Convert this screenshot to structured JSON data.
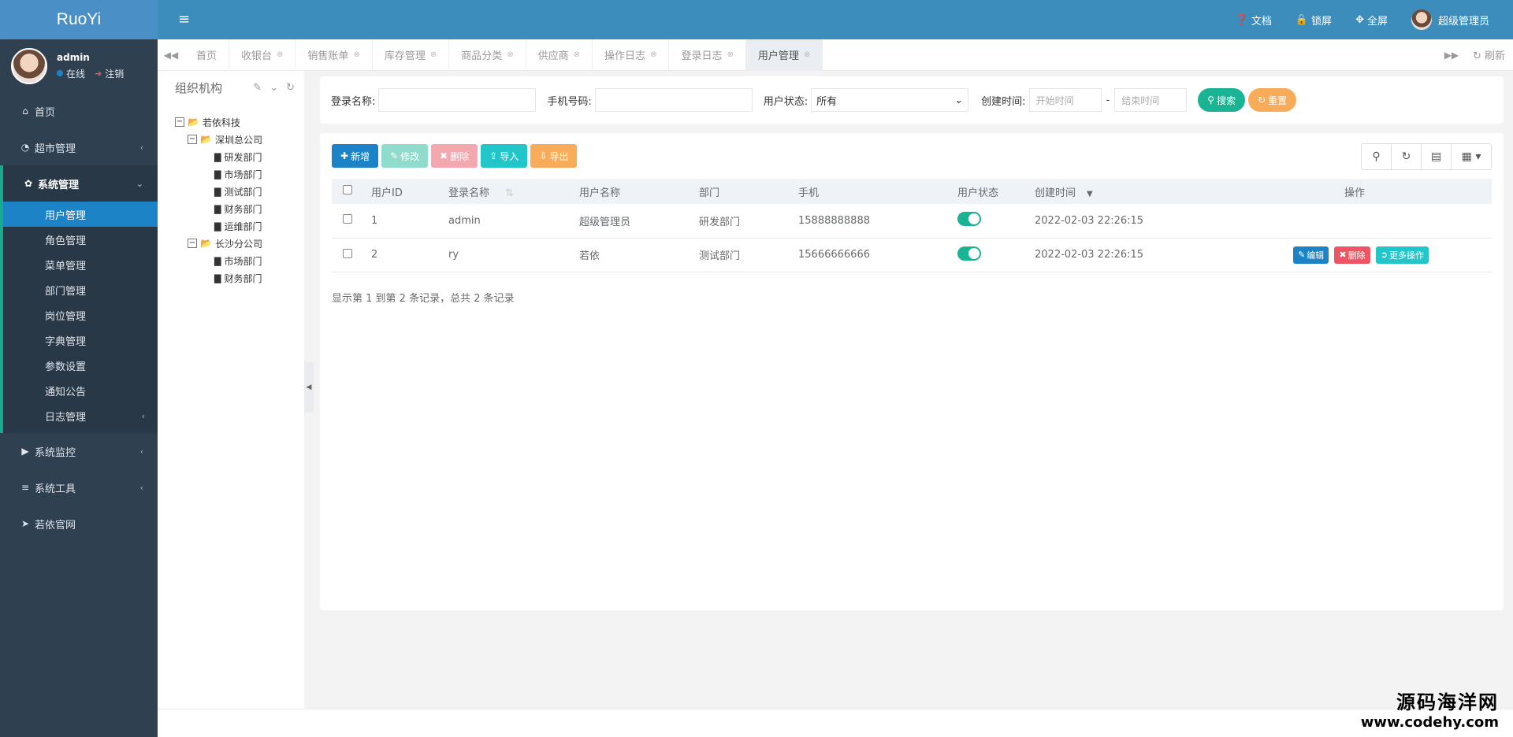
{
  "app": {
    "logo": "RuoYi"
  },
  "profile": {
    "name": "admin",
    "status": "在线",
    "logout": "注销"
  },
  "sidebar": {
    "items": [
      {
        "label": "首页",
        "icon": "home-icon"
      },
      {
        "label": "超市管理",
        "icon": "gauge-icon"
      },
      {
        "label": "系统管理",
        "icon": "gear-icon"
      },
      {
        "label": "系统监控",
        "icon": "video-icon"
      },
      {
        "label": "系统工具",
        "icon": "bars-icon"
      },
      {
        "label": "若依官网",
        "icon": "location-arrow-icon"
      }
    ],
    "submenu": [
      {
        "label": "用户管理"
      },
      {
        "label": "角色管理"
      },
      {
        "label": "菜单管理"
      },
      {
        "label": "部门管理"
      },
      {
        "label": "岗位管理"
      },
      {
        "label": "字典管理"
      },
      {
        "label": "参数设置"
      },
      {
        "label": "通知公告"
      },
      {
        "label": "日志管理"
      }
    ]
  },
  "header": {
    "docs": "文档",
    "lock": "锁屏",
    "fullscreen": "全屏",
    "user": "超级管理员"
  },
  "tabs": {
    "items": [
      "首页",
      "收银台",
      "销售账单",
      "库存管理",
      "商品分类",
      "供应商",
      "操作日志",
      "登录日志",
      "用户管理"
    ],
    "refresh": "刷新"
  },
  "tree": {
    "title": "组织机构",
    "root": "若依科技",
    "company1": "深圳总公司",
    "company1_depts": [
      "研发部门",
      "市场部门",
      "测试部门",
      "财务部门",
      "运维部门"
    ],
    "company2": "长沙分公司",
    "company2_depts": [
      "市场部门",
      "财务部门"
    ]
  },
  "search": {
    "login_label": "登录名称:",
    "phone_label": "手机号码:",
    "status_label": "用户状态:",
    "status_value": "所有",
    "time_label": "创建时间:",
    "start_placeholder": "开始时间",
    "dash": "-",
    "end_placeholder": "结束时间",
    "search_btn": "搜索",
    "reset_btn": "重置"
  },
  "toolbar": {
    "add": "新增",
    "edit": "修改",
    "delete": "删除",
    "import": "导入",
    "export": "导出"
  },
  "table": {
    "headers": [
      "用户ID",
      "登录名称",
      "用户名称",
      "部门",
      "手机",
      "用户状态",
      "创建时间",
      "操作"
    ],
    "rows": [
      {
        "id": "1",
        "login": "admin",
        "name": "超级管理员",
        "dept": "研发部门",
        "phone": "15888888888",
        "created": "2022-02-03 22:26:15"
      },
      {
        "id": "2",
        "login": "ry",
        "name": "若依",
        "dept": "测试部门",
        "phone": "15666666666",
        "created": "2022-02-03 22:26:15"
      }
    ],
    "op_edit": "编辑",
    "op_delete": "删除",
    "op_more": "更多操作",
    "pagination": "显示第 1 到第 2 条记录，总共 2 条记录"
  },
  "watermark": {
    "line1": "源码海洋网",
    "line2": "www.codehy.com"
  },
  "colors": {
    "sidebar": "#2f4050",
    "header": "#3c8dbc",
    "active": "#1c84c6",
    "primary": "#1c84c6",
    "success": "#1ab394",
    "info": "#23c6c8",
    "danger": "#ed5565",
    "warning": "#f8ac59"
  }
}
